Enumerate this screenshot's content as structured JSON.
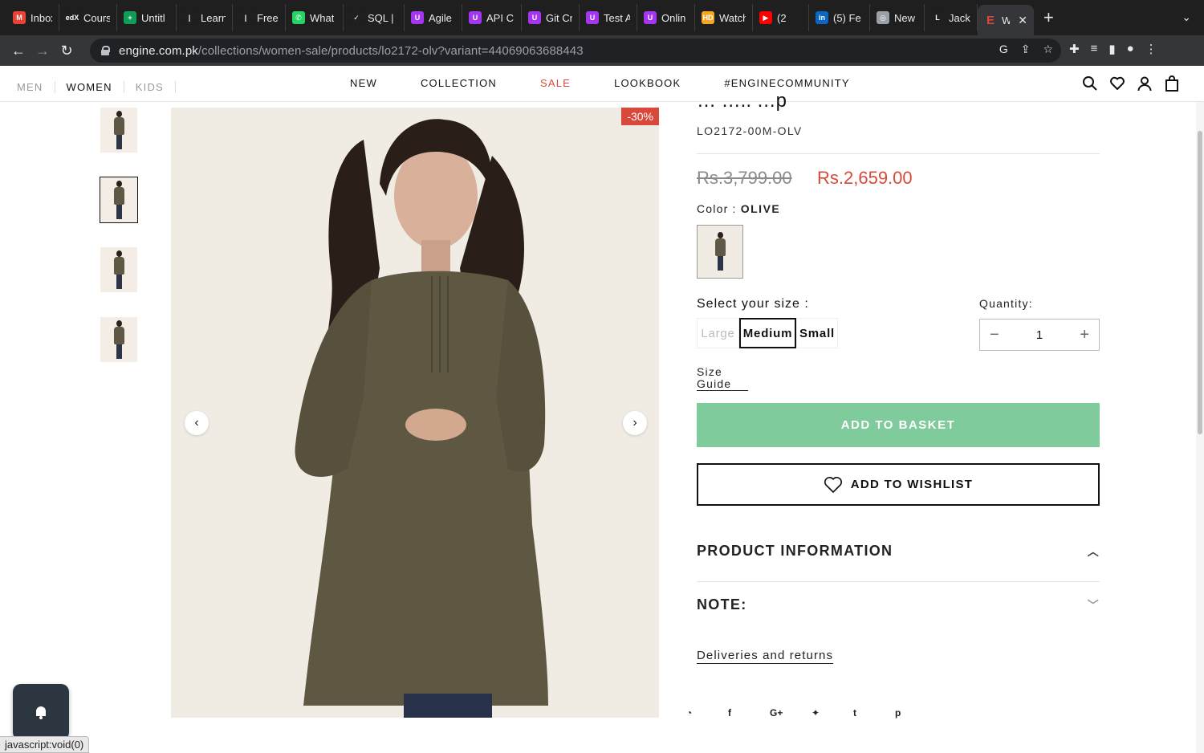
{
  "browser": {
    "tabs": [
      {
        "title": "Inbox",
        "icon": "gmail-icon",
        "color": "#ea4335",
        "glyph": "M"
      },
      {
        "title": "Cours",
        "icon": "edx-icon",
        "color": "#1f1f1f",
        "glyph": "edX"
      },
      {
        "title": "Untitl",
        "icon": "sheets-icon",
        "color": "#0f9d58",
        "glyph": "+"
      },
      {
        "title": "Learn",
        "icon": "bars-icon",
        "color": "#1f1f1f",
        "glyph": "|"
      },
      {
        "title": "Free (",
        "icon": "bars-icon",
        "color": "#1f1f1f",
        "glyph": "|"
      },
      {
        "title": "What",
        "icon": "whatsapp-icon",
        "color": "#25d366",
        "glyph": "✆"
      },
      {
        "title": "SQL |",
        "icon": "check-icon",
        "color": "#1f1f1f",
        "glyph": "✓"
      },
      {
        "title": "Agile",
        "icon": "udemy-icon",
        "color": "#a435f0",
        "glyph": "U"
      },
      {
        "title": "API C",
        "icon": "udemy-icon",
        "color": "#a435f0",
        "glyph": "U"
      },
      {
        "title": "Git Cr",
        "icon": "udemy-icon",
        "color": "#a435f0",
        "glyph": "U"
      },
      {
        "title": "Test A",
        "icon": "udemy-icon",
        "color": "#a435f0",
        "glyph": "U"
      },
      {
        "title": "Onlin",
        "icon": "udemy-icon",
        "color": "#a435f0",
        "glyph": "U"
      },
      {
        "title": "Watch",
        "icon": "hd-icon",
        "color": "#f5a623",
        "glyph": "HD"
      },
      {
        "title": "(2",
        "icon": "youtube-icon",
        "color": "#ff0000",
        "glyph": "▶"
      },
      {
        "title": "(5) Fe",
        "icon": "linkedin-icon",
        "color": "#0a66c2",
        "glyph": "in"
      },
      {
        "title": "New T",
        "icon": "chrome-icon",
        "color": "#9aa0a6",
        "glyph": "◎"
      },
      {
        "title": "Jacke",
        "icon": "l-icon",
        "color": "#1f1f1f",
        "glyph": "L"
      }
    ],
    "active_tab": {
      "title": "W",
      "icon": "engine-icon",
      "color": "#d9493b",
      "glyph": "E"
    },
    "url_host": "engine.com.pk",
    "url_path": "/collections/women-sale/products/lo2172-olv?variant=44069063688443"
  },
  "site": {
    "gender_nav": [
      "MEN",
      "WOMEN",
      "KIDS"
    ],
    "active_gender": "WOMEN",
    "main_nav": [
      "NEW",
      "COLLECTION",
      "SALE",
      "LOOKBOOK",
      "#ENGINECOMMUNITY"
    ],
    "sale_color": "#d9493b"
  },
  "product": {
    "title_partial": "…  ….. …p",
    "sku": "LO2172-00M-OLV",
    "price_old": "Rs.3,799.00",
    "price_new": "Rs.2,659.00",
    "discount_badge": "-30%",
    "color_label": "Color :",
    "color_value": "OLIVE",
    "size_label": "Select your size :",
    "sizes": [
      "Large",
      "Medium",
      "Small"
    ],
    "selected_size": "Medium",
    "unavailable_sizes": [
      "Large"
    ],
    "quantity_label": "Quantity:",
    "quantity": "1",
    "size_guide_line1": "Size",
    "size_guide_line2": "Guide",
    "add_to_basket": "ADD TO BASKET",
    "add_to_wishlist": "ADD TO WISHLIST",
    "accordion_info": "PRODUCT INFORMATION",
    "accordion_note": "NOTE:",
    "deliveries": "Deliveries and returns",
    "share_icons": [
      "whatsapp-icon",
      "facebook-icon",
      "google-plus-icon",
      "twitter-icon",
      "tumblr-icon",
      "pinterest-icon"
    ],
    "share_glyphs": [
      "◔",
      "f",
      "G+",
      "✦",
      "t",
      "p"
    ],
    "accent_button": "#7fcb9c"
  },
  "status_bar": "javascript:void(0)"
}
